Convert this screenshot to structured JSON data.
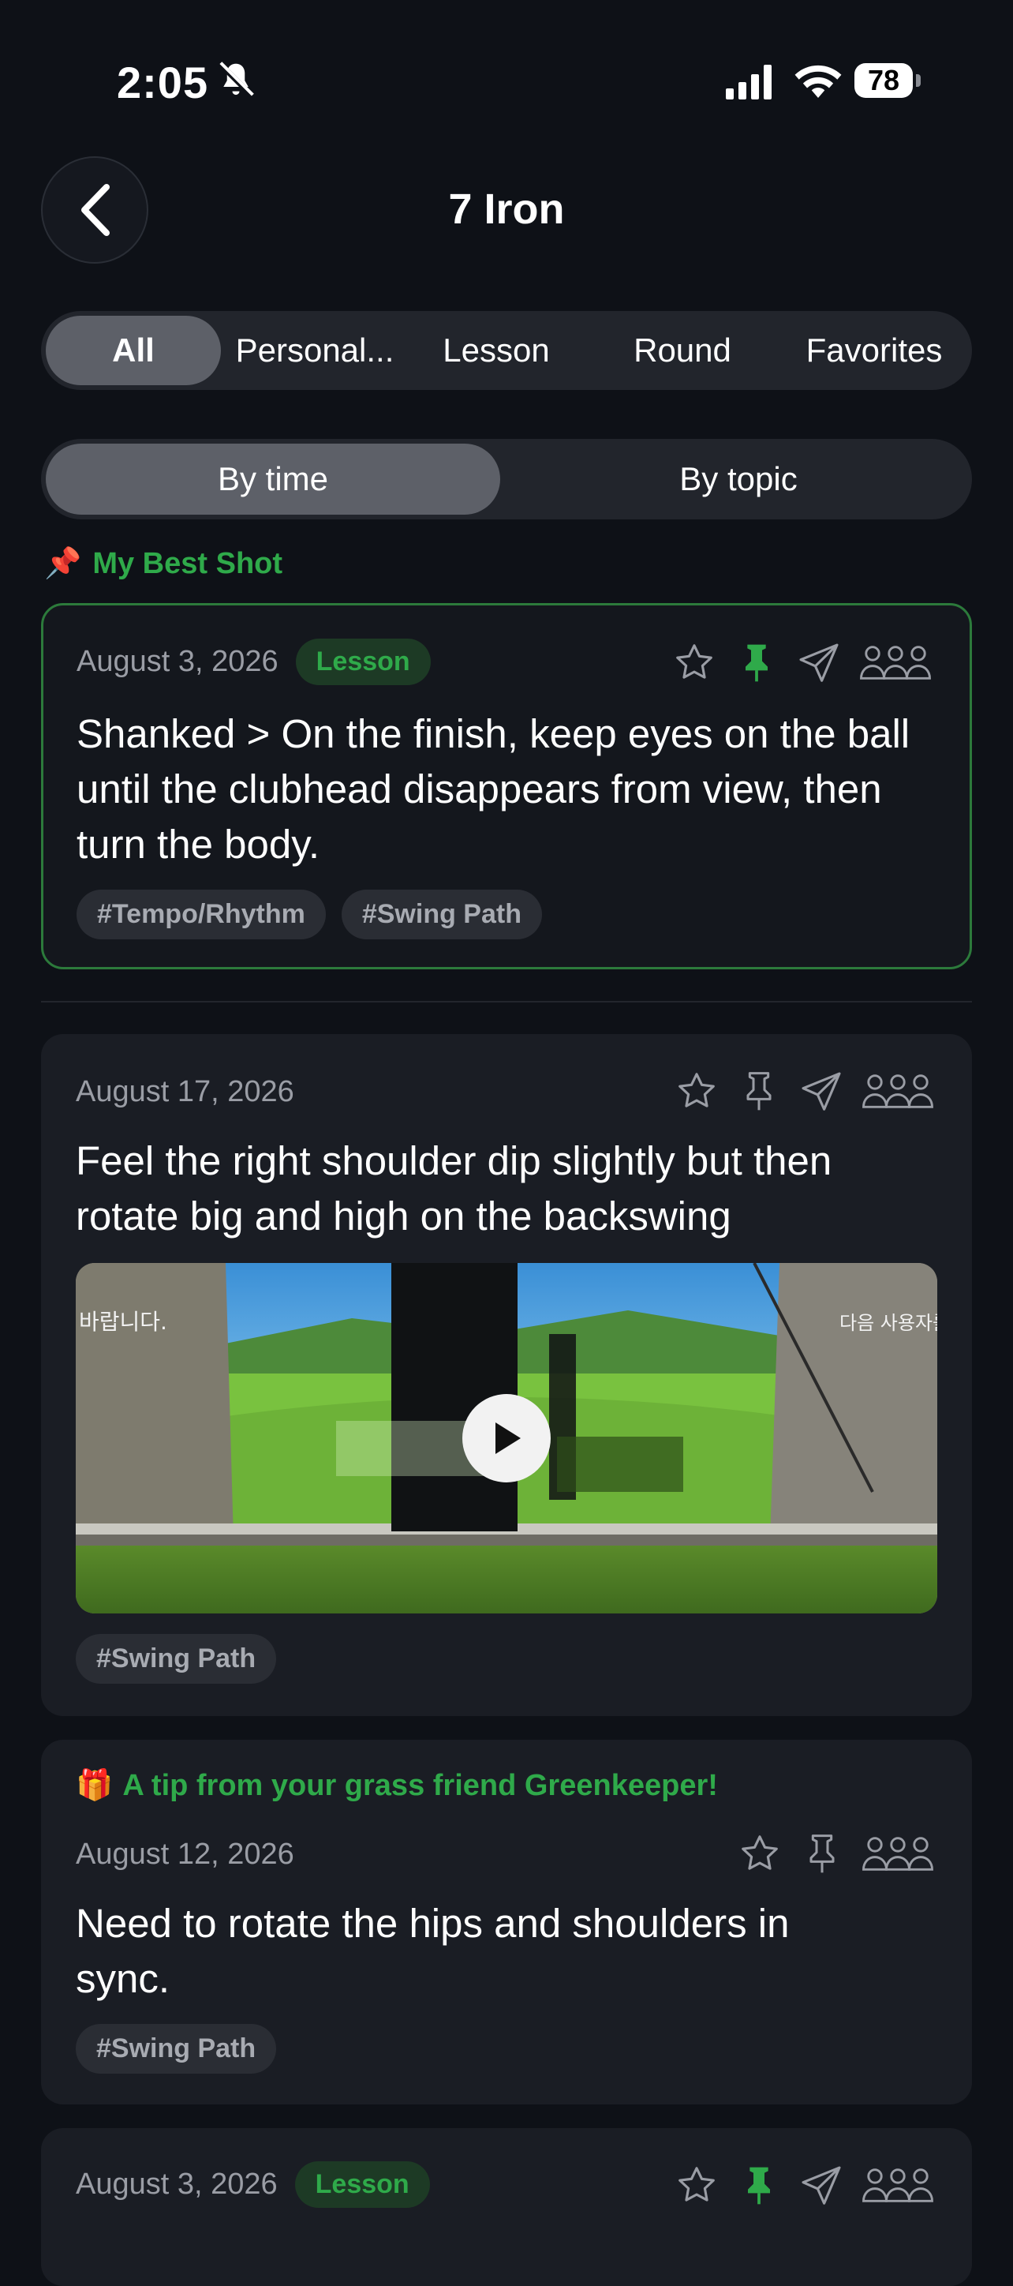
{
  "status_bar": {
    "time": "2:05",
    "battery": "78"
  },
  "header": {
    "title": "7 Iron"
  },
  "filter_tabs": [
    {
      "label": "All",
      "active": true
    },
    {
      "label": "Personal...",
      "active": false
    },
    {
      "label": "Lesson",
      "active": false
    },
    {
      "label": "Round",
      "active": false
    },
    {
      "label": "Favorites",
      "active": false
    }
  ],
  "sort": {
    "by_time": "By time",
    "by_topic": "By topic",
    "selected": "By time"
  },
  "pinned_section": {
    "emoji": "📌",
    "label": "My Best Shot"
  },
  "cards": [
    {
      "date": "August 3, 2026",
      "badge": "Lesson",
      "text": "Shanked > On the finish, keep eyes on the ball until the clubhead disappears from view, then turn the body.",
      "tags": [
        "#Tempo/Rhythm",
        "#Swing Path"
      ],
      "pinned": true
    },
    {
      "date": "August 17, 2026",
      "text": "Feel the right shoulder dip slightly but then rotate big and high on the backswing",
      "video": {
        "overlay_left": "바랍니다.",
        "overlay_right": "다음 사용자를 위"
      },
      "tags": [
        "#Swing Path"
      ],
      "pinned": false
    },
    {
      "tip_emoji": "🎁",
      "tip": "A tip from your grass friend Greenkeeper!",
      "date": "August 12, 2026",
      "text": "Need to rotate the hips and shoulders in sync.",
      "tags": [
        "#Swing Path"
      ],
      "pinned": false
    },
    {
      "date": "August 3, 2026",
      "badge": "Lesson",
      "pinned": true
    }
  ],
  "colors": {
    "accent": "#2faa4a",
    "background": "#0e1117",
    "card": "#1a1d24",
    "chip": "#22252c"
  }
}
